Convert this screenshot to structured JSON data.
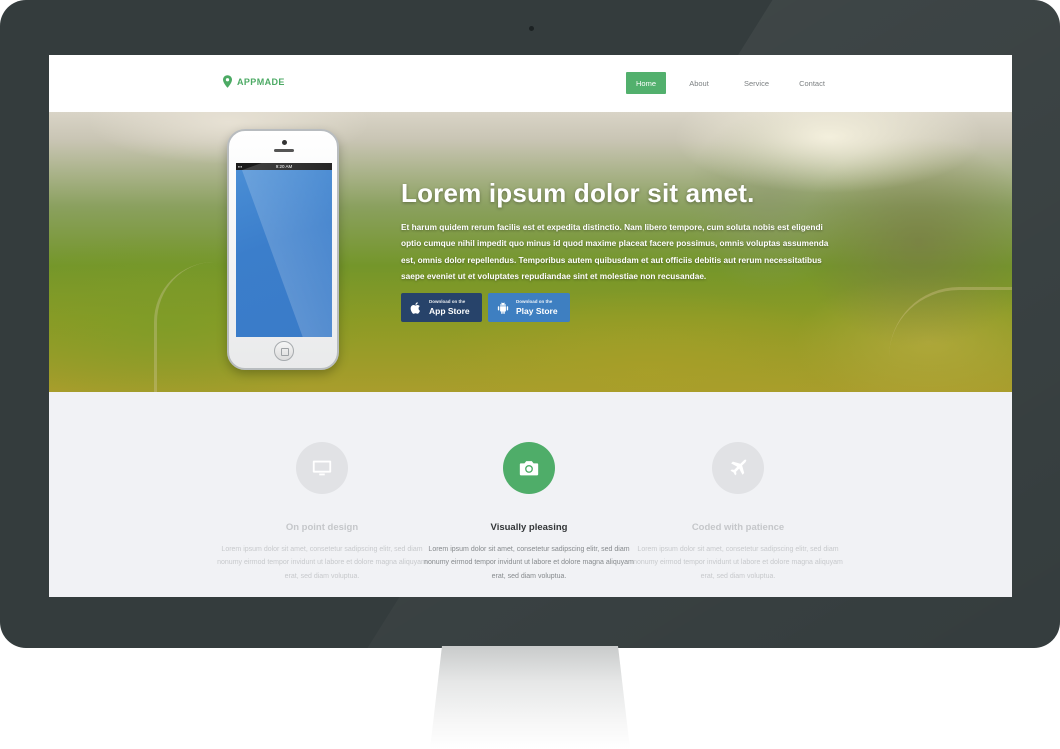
{
  "nav": {
    "brand": "APPMADE",
    "items": [
      {
        "label": "Home",
        "active": true
      },
      {
        "label": "About"
      },
      {
        "label": "Service"
      },
      {
        "label": "Contact"
      }
    ]
  },
  "phone": {
    "status_time": "9:20 AM"
  },
  "hero": {
    "title": "Lorem ipsum dolor sit amet.",
    "text": "Et harum quidem rerum facilis est et expedita distinctio. Nam libero tempore, cum soluta nobis est eligendi optio cumque nihil impedit quo minus id quod maxime placeat facere possimus, omnis voluptas assumenda est, omnis dolor repellendus. Temporibus autem quibusdam et aut officiis debitis aut rerum necessitatibus saepe eveniet ut et voluptates repudiandae sint et molestiae non recusandae.",
    "buttons": [
      {
        "small": "Download on the",
        "big": "App Store",
        "icon": "apple-icon"
      },
      {
        "small": "Download on the",
        "big": "Play Store",
        "icon": "android-icon"
      }
    ]
  },
  "features": [
    {
      "title": "On point design",
      "icon": "monitor-icon",
      "active": false,
      "text": "Lorem ipsum dolor sit amet, consetetur sadipscing elitr, sed diam nonumy eirmod tempor invidunt ut labore et dolore magna aliquyam erat, sed diam voluptua."
    },
    {
      "title": "Visually pleasing",
      "icon": "camera-icon",
      "active": true,
      "text": "Lorem ipsum dolor sit amet, consetetur sadipscing elitr, sed diam nonumy eirmod tempor invidunt ut labore et dolore magna aliquyam erat, sed diam voluptua."
    },
    {
      "title": "Coded with patience",
      "icon": "airplane-icon",
      "active": false,
      "text": "Lorem ipsum dolor sit amet, consetetur sadipscing elitr, sed diam nonumy eirmod tempor invidunt ut labore et dolore magna aliquyam erat, sed diam voluptua."
    }
  ],
  "colors": {
    "accent": "#52b06d",
    "monitor_frame": "#343c3d",
    "app_store_button": "#27436a",
    "play_store_button": "#3e7fc1"
  }
}
